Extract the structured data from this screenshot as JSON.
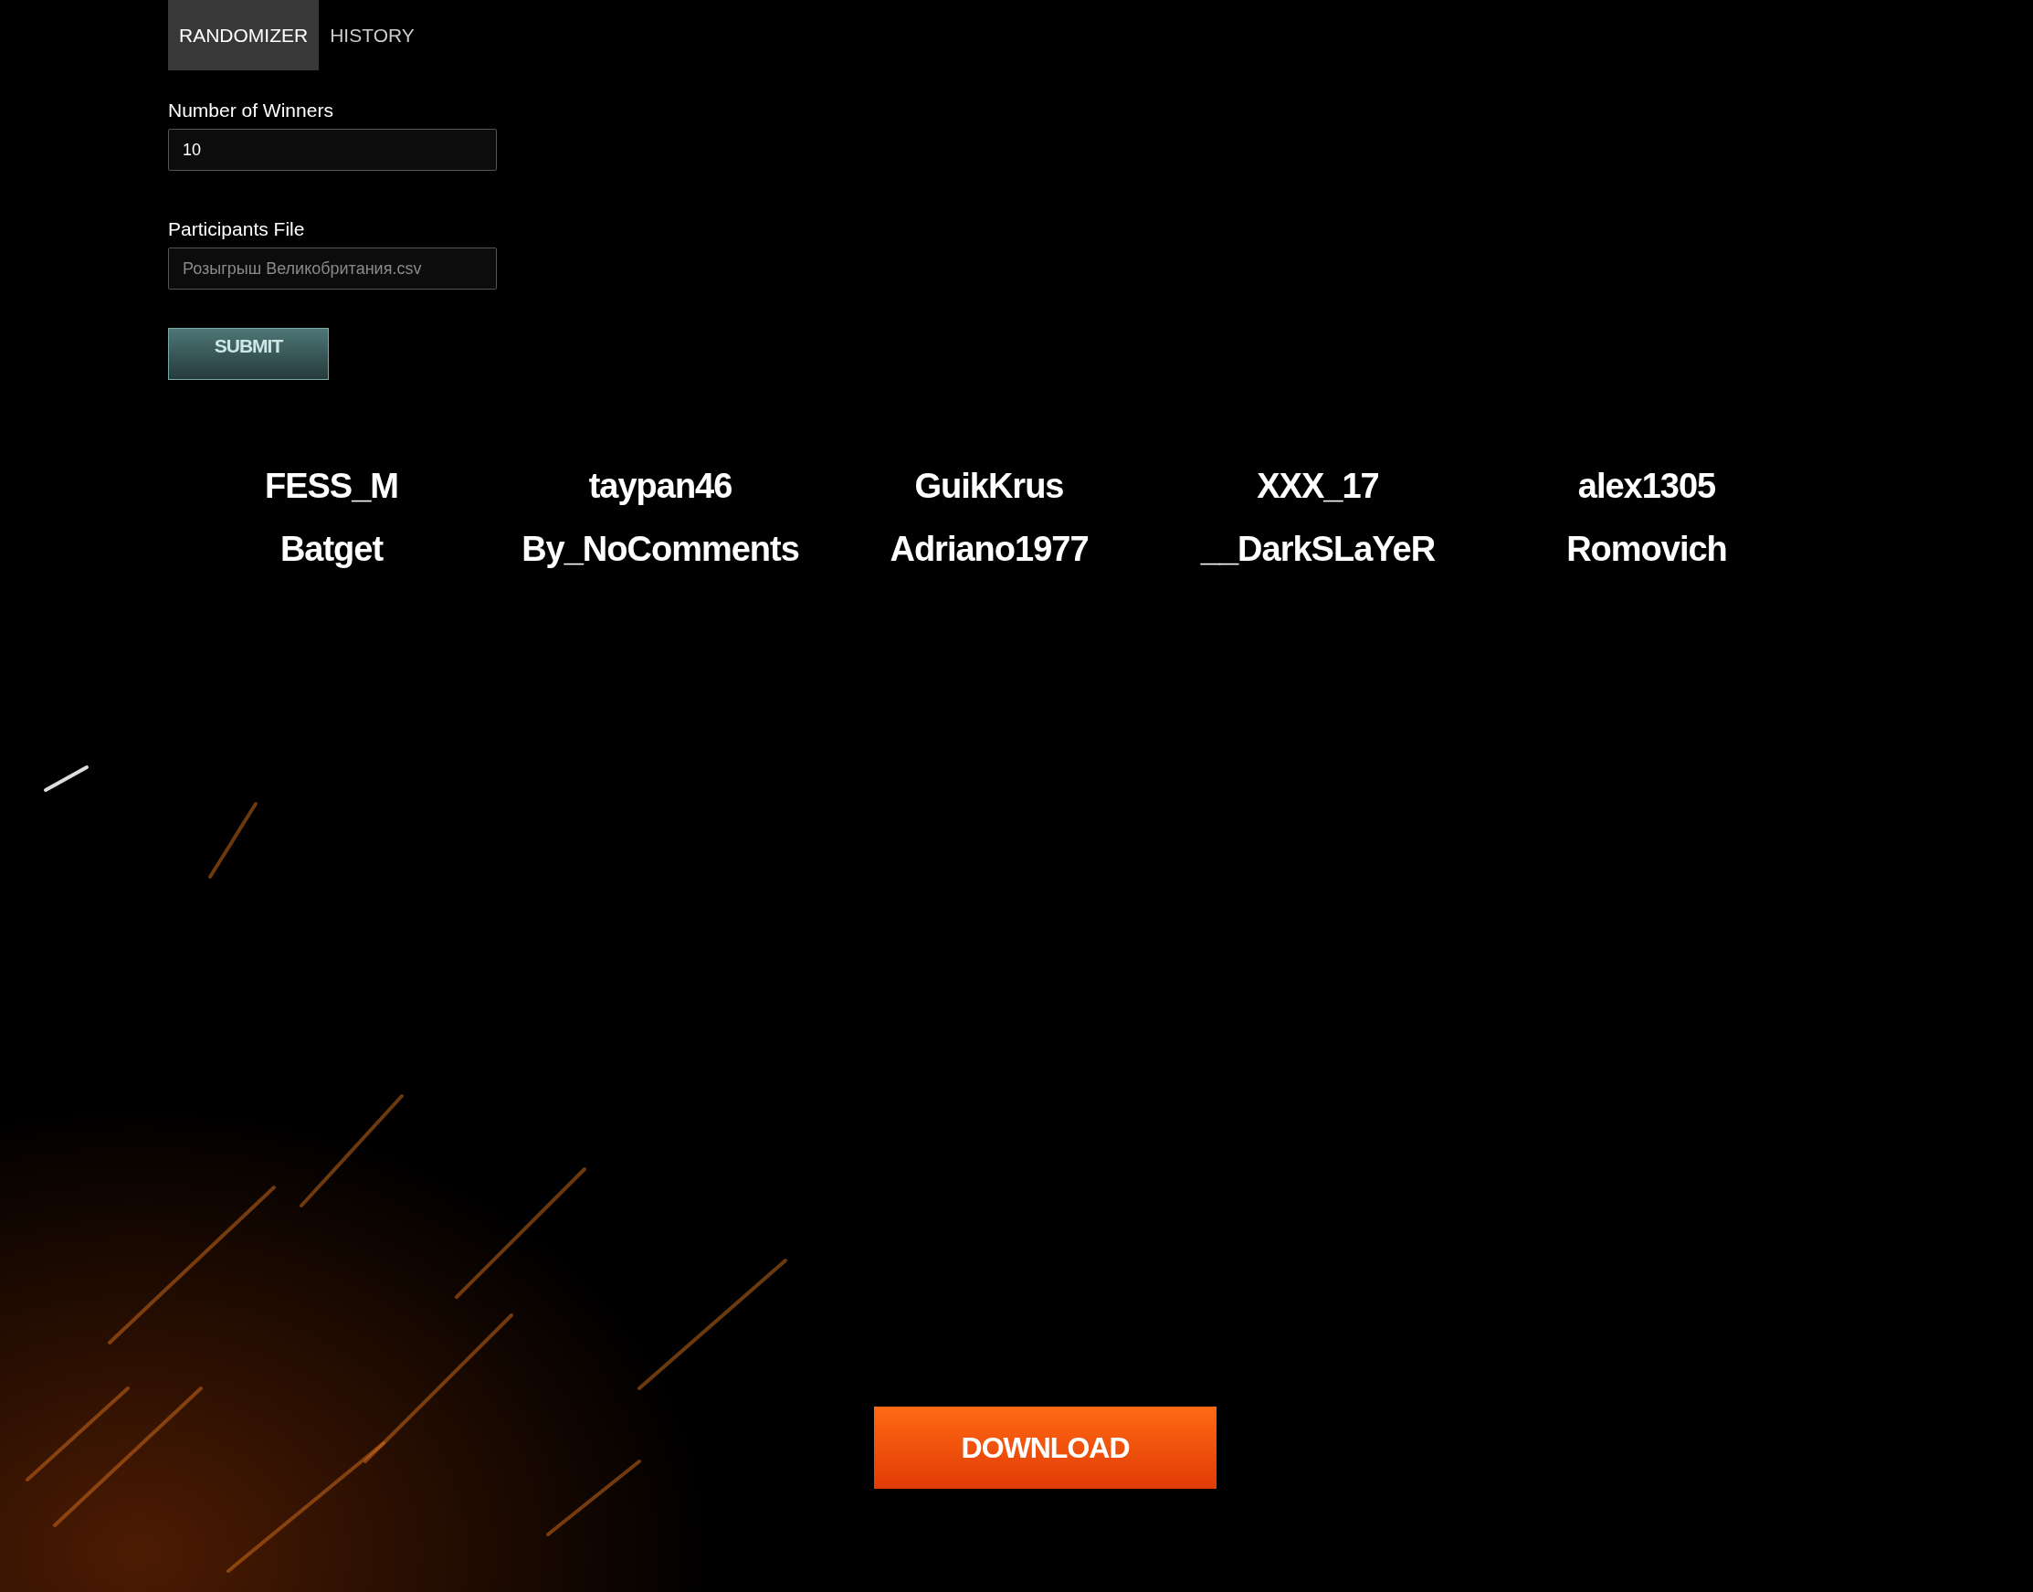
{
  "tabs": [
    {
      "label": "RANDOMIZER",
      "selected": true
    },
    {
      "label": "HISTORY",
      "selected": false
    }
  ],
  "form": {
    "fields": [
      {
        "label": "Number of Winners",
        "value": "10",
        "kind": "number"
      },
      {
        "label": "Participants File",
        "value": "Розыгрыш Великобритания.csv",
        "kind": "file"
      }
    ],
    "submit": "SUBMIT"
  },
  "winners": [
    "FESS_M",
    "taypan46",
    "GuikKrus",
    "XXX_17",
    "alex1305",
    "Batget",
    "By_NoComments",
    "Adriano1977",
    "__DarkSLaYeR",
    "Romovich"
  ],
  "download": "DOWNLOAD"
}
